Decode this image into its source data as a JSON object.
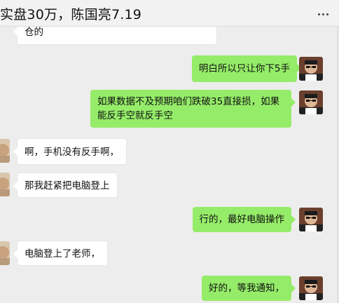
{
  "window": {
    "title": "实盘30万，陈国亮7.19",
    "menu_icon": "more-dots-icon"
  },
  "messages": [
    {
      "side": "in",
      "text": "仓的"
    },
    {
      "side": "out",
      "text": "明白所以只让你下5手"
    },
    {
      "side": "out",
      "text": "如果数据不及预期咱们跌破35直接损，如果能反手空就反手空"
    },
    {
      "side": "in",
      "text": "啊，手机没有反手啊，"
    },
    {
      "side": "in",
      "text": "那我赶紧把电脑登上"
    },
    {
      "side": "out",
      "text": "行的，最好电脑操作"
    },
    {
      "side": "in",
      "text": "电脑登上了老师，"
    },
    {
      "side": "out",
      "text": "好的，等我通知，"
    }
  ],
  "colors": {
    "outgoing_bubble": "#95ec69",
    "incoming_bubble": "#ffffff",
    "background": "#ededed"
  }
}
